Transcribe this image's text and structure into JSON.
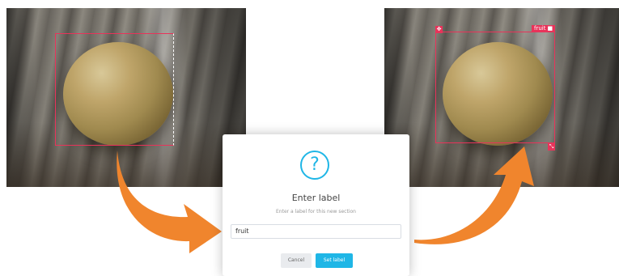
{
  "annotation": {
    "label_tag": "fruit",
    "move_icon": "move-icon",
    "delete_icon": "trash-icon",
    "resize_icon": "resize-icon",
    "color": "#e8335a"
  },
  "dialog": {
    "icon": "question-icon",
    "title": "Enter label",
    "subtitle": "Enter a label for this new section",
    "input_value": "fruit",
    "cancel_label": "Cancel",
    "set_label": "Set label",
    "accent": "#1fb6e6"
  },
  "arrows": {
    "color": "#f0852d"
  }
}
